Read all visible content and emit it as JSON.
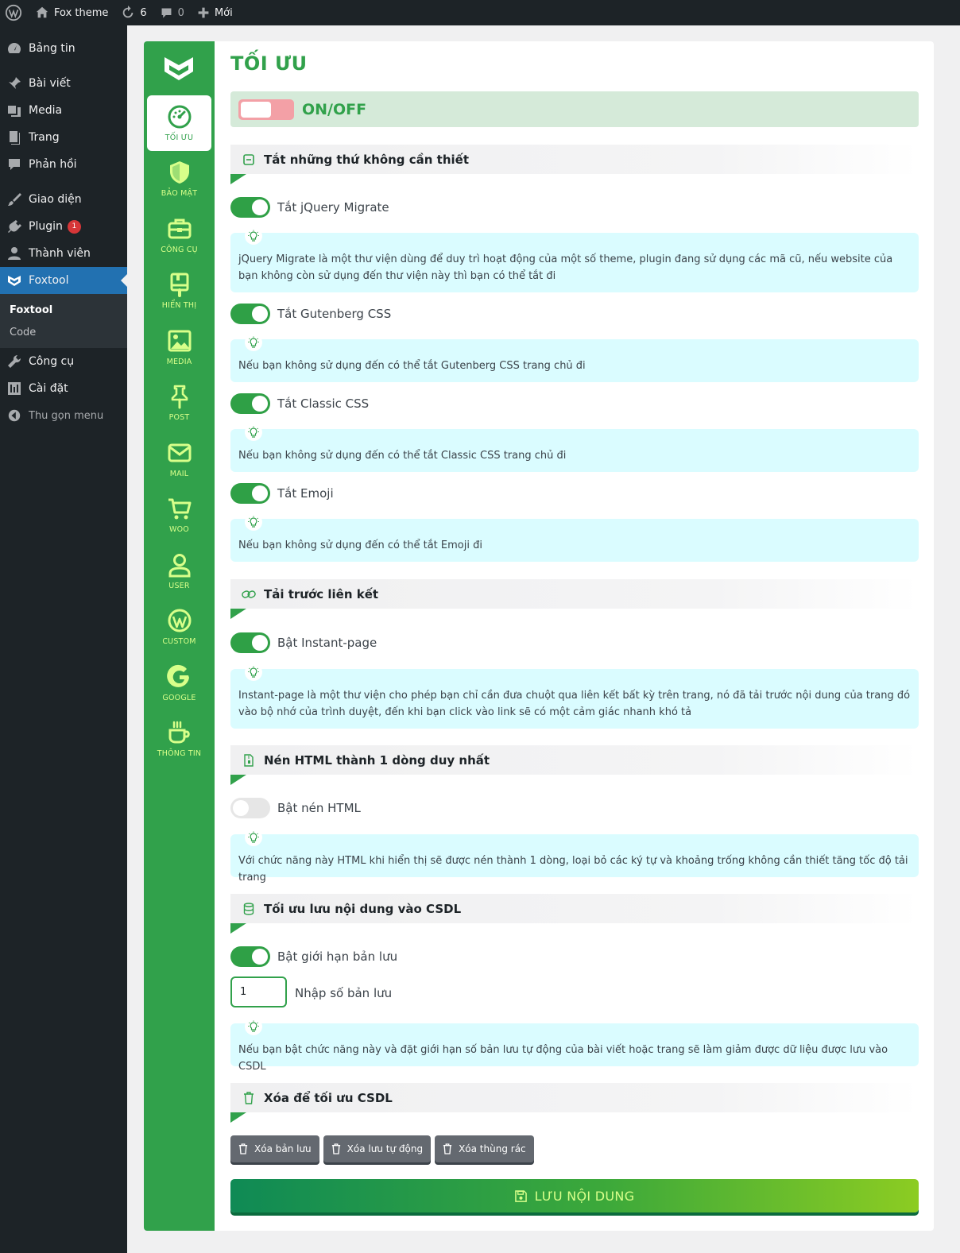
{
  "adminbar": {
    "site_name": "Fox theme",
    "updates_count": "6",
    "comments_count": "0",
    "new_label": "Mới"
  },
  "menu": {
    "items": [
      {
        "label": "Bảng tin",
        "icon": "dashboard-icon"
      },
      {
        "label": "Bài viết",
        "icon": "pin-icon"
      },
      {
        "label": "Media",
        "icon": "media-icon"
      },
      {
        "label": "Trang",
        "icon": "page-icon"
      },
      {
        "label": "Phản hồi",
        "icon": "comment-icon"
      },
      {
        "label": "Giao diện",
        "icon": "brush-icon"
      },
      {
        "label": "Plugin",
        "icon": "plugin-icon",
        "badge": "1"
      },
      {
        "label": "Thành viên",
        "icon": "user-icon"
      },
      {
        "label": "Foxtool",
        "icon": "foxtool-icon"
      },
      {
        "label": "Công cụ",
        "icon": "wrench-icon"
      },
      {
        "label": "Cài đặt",
        "icon": "settings-icon"
      },
      {
        "label": "Thu gọn menu",
        "icon": "collapse-icon"
      }
    ],
    "submenu": [
      "Foxtool",
      "Code"
    ]
  },
  "fnav": {
    "items": [
      {
        "label": "TỐI ƯU",
        "icon": "speedometer-icon"
      },
      {
        "label": "BẢO MẬT",
        "icon": "shield-icon"
      },
      {
        "label": "CÔNG CỤ",
        "icon": "toolbox-icon"
      },
      {
        "label": "HIỂN THỊ",
        "icon": "display-icon"
      },
      {
        "label": "MEDIA",
        "icon": "image-icon"
      },
      {
        "label": "POST",
        "icon": "pushpin-icon"
      },
      {
        "label": "MAIL",
        "icon": "mail-icon"
      },
      {
        "label": "WOO",
        "icon": "cart-icon"
      },
      {
        "label": "USER",
        "icon": "person-icon"
      },
      {
        "label": "CUSTOM",
        "icon": "wordpress-icon"
      },
      {
        "label": "GOOGLE",
        "icon": "google-icon"
      },
      {
        "label": "THÔNG TIN",
        "icon": "coffee-icon"
      }
    ]
  },
  "page": {
    "title": "TỐI ƯU",
    "onoff_label": "ON/OFF"
  },
  "sections": [
    {
      "title": "Tắt những thứ không cần thiết",
      "icon": "minus-square-icon"
    },
    {
      "title": "Tải trước liên kết",
      "icon": "link-icon"
    },
    {
      "title": "Nén HTML thành 1 dòng duy nhất",
      "icon": "file-zip-icon"
    },
    {
      "title": "Tối ưu lưu nội dung vào CSDL",
      "icon": "database-icon"
    },
    {
      "title": "Xóa để tối ưu CSDL",
      "icon": "trash-icon"
    }
  ],
  "toggles": [
    {
      "label": "Tắt jQuery Migrate",
      "on": true
    },
    {
      "label": "Tắt Gutenberg CSS",
      "on": true
    },
    {
      "label": "Tắt Classic CSS",
      "on": true
    },
    {
      "label": "Tắt Emoji",
      "on": true
    },
    {
      "label": "Bật Instant-page",
      "on": true
    },
    {
      "label": "Bật nén HTML",
      "on": false
    },
    {
      "label": "Bật giới hạn bản lưu",
      "on": true
    }
  ],
  "infos": [
    "jQuery Migrate là một thư viện dùng để duy trì hoạt động của một số theme, plugin đang sử dụng các mã cũ, nếu website của bạn không còn sử dụng đến thư viện này thì bạn có thể tắt đi",
    "Nếu bạn không sử dụng đến có thể tắt Gutenberg CSS trang chủ đi",
    "Nếu bạn không sử dụng đến có thể tắt Classic CSS trang chủ đi",
    "Nếu bạn không sử dụng đến có thể tắt Emoji đi",
    "Instant-page là một thư viện cho phép bạn chỉ cần đưa chuột qua liên kết bất kỳ trên trang, nó đã tải trước nội dung của trang đó vào bộ nhớ của trình duyệt, đến khi bạn click vào link sẽ có một cảm giác nhanh khó tả",
    "Với chức năng này HTML khi hiển thị sẽ được nén thành 1 dòng, loại bỏ các ký tự và khoảng trống không cần thiết tăng tốc độ tải trang",
    "Nếu bạn bật chức năng này và đặt giới hạn số bản lưu tự động của bài viết hoặc trang sẽ làm giảm được dữ liệu được lưu vào CSDL"
  ],
  "revisions": {
    "value": "1",
    "label": "Nhập số bản lưu"
  },
  "buttons": {
    "delete_revisions": "Xóa bản lưu",
    "delete_autosave": "Xóa lưu tự động",
    "delete_trash": "Xóa thùng rác",
    "save": "LƯU NỘI DUNG"
  },
  "colors": {
    "accent_green": "#31a14b",
    "admin_dark": "#1d2327",
    "wp_blue": "#2271b1",
    "info_bg": "#dafcff",
    "nav_text": "#d8ff8a"
  }
}
